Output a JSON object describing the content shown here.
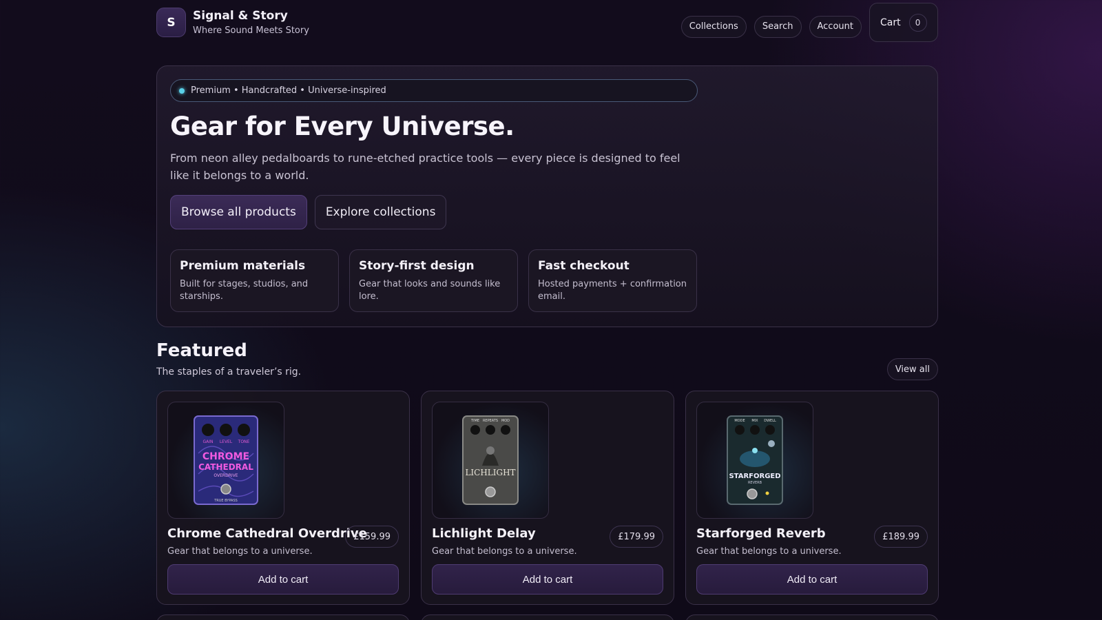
{
  "brand": {
    "initial": "S",
    "name": "Signal & Story",
    "tagline": "Where Sound Meets Story"
  },
  "nav": {
    "items": [
      "Collections",
      "Search",
      "Account"
    ],
    "cart_label": "Cart",
    "cart_count": "0"
  },
  "hero": {
    "pill": "Premium • Handcrafted • Universe-inspired",
    "title": "Gear for Every Universe.",
    "description": "From neon alley pedalboards to rune-etched practice tools — every piece is designed to feel like it belongs to a world.",
    "primary_button": "Browse all products",
    "secondary_button": "Explore collections",
    "features": [
      {
        "title": "Premium materials",
        "desc": "Built for stages, studios, and starships."
      },
      {
        "title": "Story-first design",
        "desc": "Gear that looks and sounds like lore."
      },
      {
        "title": "Fast checkout",
        "desc": "Hosted payments + confirmation email."
      }
    ]
  },
  "featured": {
    "title": "Featured",
    "subtitle": "The staples of a traveler’s rig.",
    "view_all": "View all",
    "products": [
      {
        "name": "Chrome Cathedral Overdrive",
        "tagline": "Gear that belongs to a universe.",
        "price": "£159.99",
        "button": "Add to cart",
        "image": {
          "knobs": [
            "GAIN",
            "LEVEL",
            "TONE"
          ],
          "title1": "CHROME",
          "title2": "CATHEDRAL",
          "sub": "OVERDRIVE",
          "footer": "TRUE BYPASS"
        }
      },
      {
        "name": "Lichlight Delay",
        "tagline": "Gear that belongs to a universe.",
        "price": "£179.99",
        "button": "Add to cart",
        "image": {
          "knobs": [
            "TIME",
            "REPEATS",
            "MOD"
          ],
          "title1": "LICHLIGHT"
        }
      },
      {
        "name": "Starforged Reverb",
        "tagline": "Gear that belongs to a universe.",
        "price": "£189.99",
        "button": "Add to cart",
        "image": {
          "knobs": [
            "MODE",
            "MIX",
            "DWELL"
          ],
          "title1": "STARFORGED",
          "sub": "REVERB"
        }
      }
    ]
  },
  "colors": {
    "accent_purple": "#3b2b57",
    "accent_cyan": "#5ad0e8",
    "background": "#120c1c"
  }
}
